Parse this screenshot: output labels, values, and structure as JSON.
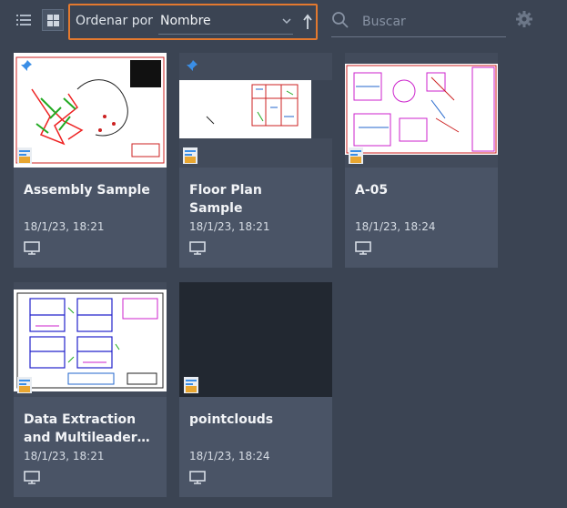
{
  "toolbar": {
    "list_view_icon": "list-icon",
    "grid_view_icon": "grid-icon",
    "sort_label": "Ordenar por",
    "sort_value": "Nombre",
    "sort_direction_icon": "arrow-up-icon",
    "search_placeholder": "Buscar",
    "settings_icon": "gear-icon"
  },
  "colors": {
    "background": "#3b4453",
    "card": "#4a5466",
    "highlight": "#e3792f",
    "pin": "#3a8ee6"
  },
  "files": [
    {
      "title": "Assembly Sample",
      "date": "18/1/23, 18:21",
      "pinned": true,
      "location_icon": "computer-icon"
    },
    {
      "title": "Floor Plan\nSample",
      "date": "18/1/23, 18:21",
      "pinned": true,
      "location_icon": "computer-icon"
    },
    {
      "title": "A-05",
      "date": "18/1/23, 18:24",
      "pinned": false,
      "location_icon": "computer-icon"
    },
    {
      "title": "Data Extraction\nand Multileader…",
      "date": "18/1/23, 18:21",
      "pinned": false,
      "location_icon": "computer-icon"
    },
    {
      "title": "pointclouds",
      "date": "18/1/23, 18:24",
      "pinned": false,
      "location_icon": "computer-icon"
    }
  ]
}
